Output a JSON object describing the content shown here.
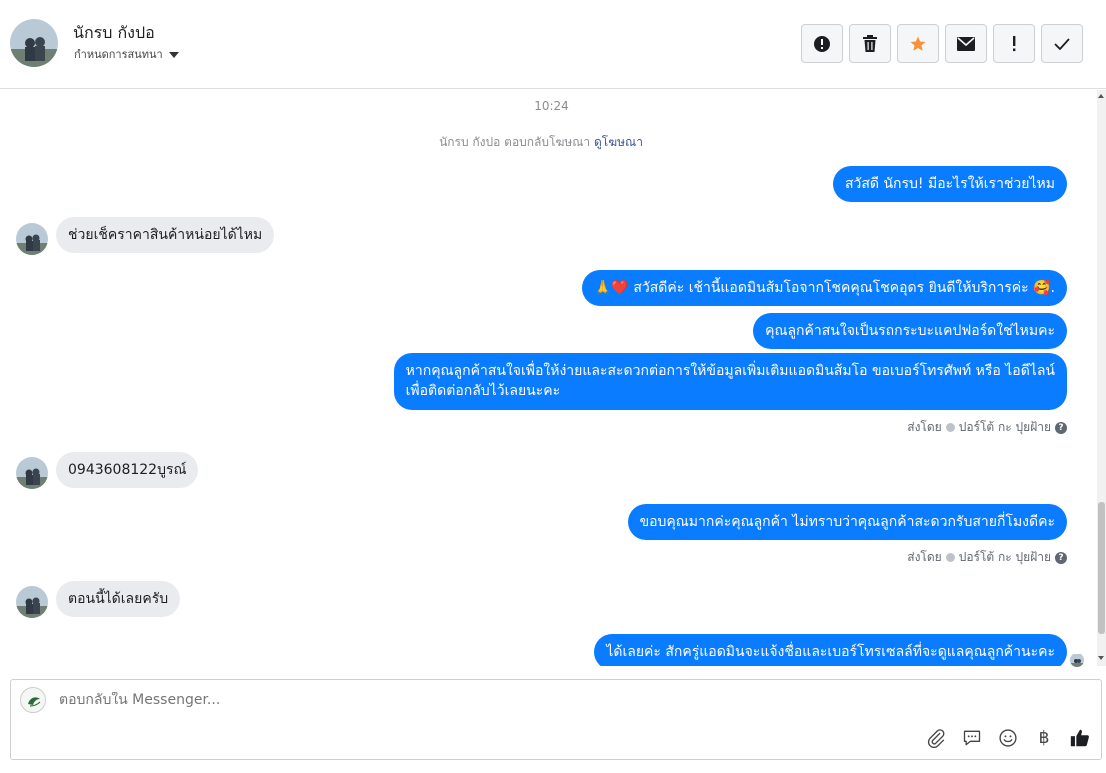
{
  "header": {
    "contact_name": "นักรบ กังปอ",
    "assign_label": "กำหนดการสนทนา"
  },
  "toolbar": {
    "buttons": [
      {
        "name": "spam-report",
        "icon": "exclamation-circle-icon"
      },
      {
        "name": "delete",
        "icon": "trash-icon"
      },
      {
        "name": "star",
        "icon": "star-icon",
        "color": "#f7923b"
      },
      {
        "name": "mark-unread",
        "icon": "envelope-icon"
      },
      {
        "name": "flag-important",
        "icon": "exclamation-icon"
      },
      {
        "name": "mark-done",
        "icon": "check-icon"
      }
    ]
  },
  "thread": {
    "timestamp": "10:24",
    "system_prefix": "นักรบ กังปอ ตอบกลับโฆษณา",
    "system_link": "ดูโฆษณา",
    "messages": {
      "m1": "สวัสดี นักรบ! มีอะไรให้เราช่วยไหม",
      "m2": "ช่วยเช็คราคาสินค้าหน่อยได้ไหม",
      "m3_emoji": "🙏❤️",
      "m3": "สวัสดีค่ะ เช้านี้แอดมินส้มโอจากโชคคุณโชคอุดร ยินดีให้บริการค่ะ",
      "m3_tail": "🥰.",
      "m4": "คุณลูกค้าสนใจเป็นรถกระบะแคปฟอร์ดใช่ไหมคะ",
      "m5_line1": "หากคุณลูกค้าสนใจเพื่อให้ง่ายและสะดวกต่อการให้ข้อมูลเพิ่มเติมแอดมินส้มโอ ขอเบอร์โทรศัพท์ หรือ ไอดีไลน์",
      "m5_line2": "เพื่อติดต่อกลับไว้เลยนะคะ",
      "m6": "0943608122บูรณ์",
      "m7": "ขอบคุณมากค่ะคุณลูกค้า ไม่ทราบว่าคุณลูกค้าสะดวกรับสายกี่โมงดีคะ",
      "m8": "ตอนนี้ได้เลยครับ",
      "m9": "ได้เลยค่ะ สักครู่แอดมินจะแจ้งชื่อและเบอร์โทรเซลล์ที่จะดูแลคุณลูกค้านะคะ"
    },
    "sent_by_label": "ส่งโดย",
    "sent_by_name": "ปอร์โต้ กะ ปุยฝ้าย"
  },
  "composer": {
    "placeholder": "ตอบกลับใน Messenger...",
    "baht_symbol": "฿",
    "tools": [
      "paperclip-icon",
      "saved-reply-icon",
      "emoji-icon",
      "baht-icon",
      "thumbs-up-icon"
    ]
  },
  "colors": {
    "outgoing_bubble": "#0a7cff",
    "incoming_bubble": "#e9ebee",
    "star": "#f7923b"
  }
}
